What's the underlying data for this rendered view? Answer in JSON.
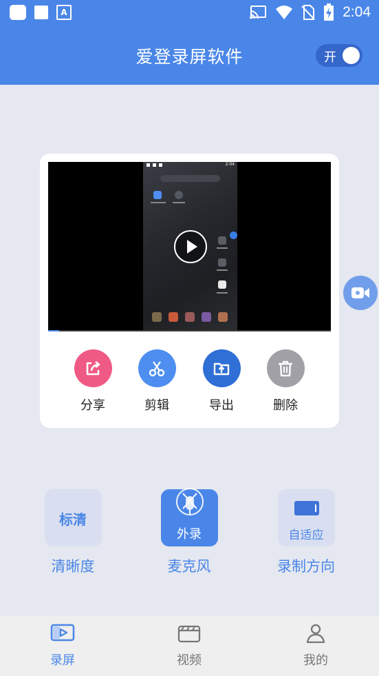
{
  "status_bar": {
    "time": "2:04",
    "left_icons": [
      "app-square-icon",
      "app-square-icon",
      "a-badge-icon"
    ],
    "a_badge": "A",
    "right_icons": [
      "cast-icon",
      "wifi-icon",
      "no-sim-icon",
      "battery-charging-icon"
    ]
  },
  "header": {
    "title": "爱登录屏软件",
    "toggle_label": "开",
    "toggle_on": true
  },
  "video_card": {
    "phone_time": "2:04",
    "progress": 0.04,
    "actions": [
      {
        "label": "分享",
        "icon": "share-icon",
        "color": "#ef5a85"
      },
      {
        "label": "剪辑",
        "icon": "scissors-icon",
        "color": "#4e8ef0"
      },
      {
        "label": "导出",
        "icon": "export-icon",
        "color": "#2f6fd6"
      },
      {
        "label": "删除",
        "icon": "trash-icon",
        "color": "#a0a0a6"
      }
    ]
  },
  "settings": [
    {
      "label": "清晰度",
      "value": "标清"
    },
    {
      "label": "麦克风",
      "value": "外录"
    },
    {
      "label": "录制方向",
      "value": "自适应"
    }
  ],
  "tabs": [
    {
      "label": "录屏",
      "icon": "record-screen-icon",
      "active": true
    },
    {
      "label": "视频",
      "icon": "clapperboard-icon",
      "active": false
    },
    {
      "label": "我的",
      "icon": "person-icon",
      "active": false
    }
  ],
  "colors": {
    "primary": "#4a86e8",
    "background": "#e5e8f0",
    "tab_inactive": "#777777"
  }
}
